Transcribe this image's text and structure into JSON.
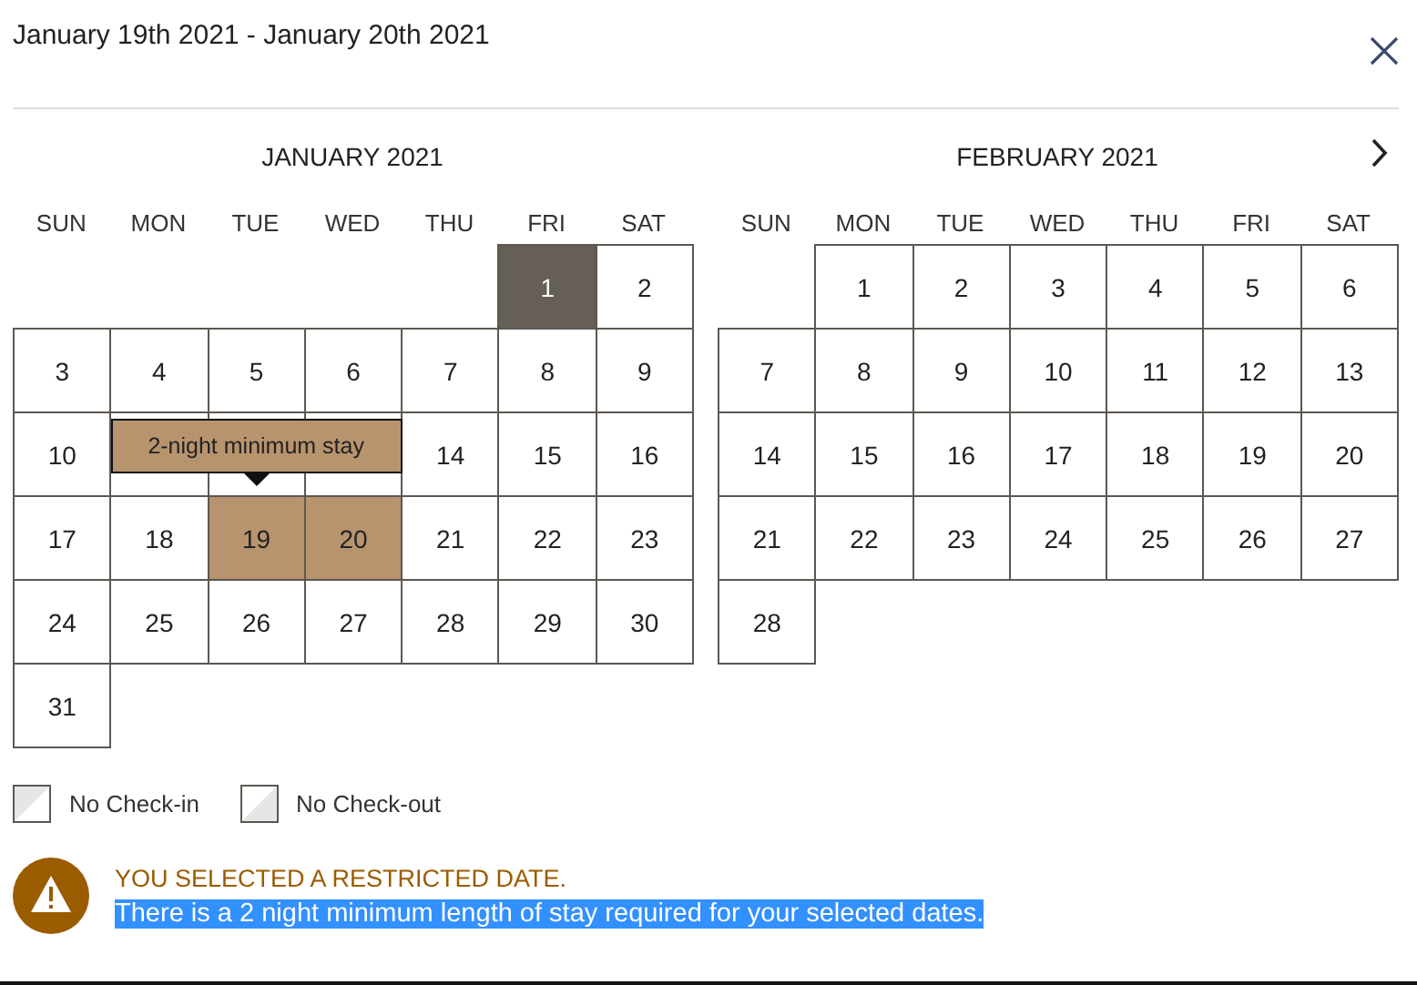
{
  "header": {
    "title": "January 19th 2021 - January 20th 2021"
  },
  "months": [
    {
      "title": "JANUARY 2021",
      "next_button": false,
      "weekdays": [
        "SUN",
        "MON",
        "TUE",
        "WED",
        "THU",
        "FRI",
        "SAT"
      ],
      "weeks": [
        [
          {
            "kind": "blank"
          },
          {
            "kind": "blank"
          },
          {
            "kind": "blank"
          },
          {
            "kind": "blank"
          },
          {
            "kind": "blank"
          },
          {
            "kind": "day",
            "day": "1",
            "selected": false,
            "unavailable": true
          },
          {
            "kind": "day",
            "day": "2",
            "selected": false,
            "unavailable": false
          }
        ],
        [
          {
            "kind": "day",
            "day": "3",
            "selected": false,
            "unavailable": false
          },
          {
            "kind": "day",
            "day": "4",
            "selected": false,
            "unavailable": false
          },
          {
            "kind": "day",
            "day": "5",
            "selected": false,
            "unavailable": false
          },
          {
            "kind": "day",
            "day": "6",
            "selected": false,
            "unavailable": false
          },
          {
            "kind": "day",
            "day": "7",
            "selected": false,
            "unavailable": false
          },
          {
            "kind": "day",
            "day": "8",
            "selected": false,
            "unavailable": false
          },
          {
            "kind": "day",
            "day": "9",
            "selected": false,
            "unavailable": false
          }
        ],
        [
          {
            "kind": "day",
            "day": "10",
            "selected": false,
            "unavailable": false
          },
          {
            "kind": "covered",
            "selected": false,
            "unavailable": false
          },
          {
            "kind": "covered",
            "selected": false,
            "unavailable": false,
            "tooltip": "2-night minimum stay"
          },
          {
            "kind": "covered",
            "selected": false,
            "unavailable": false
          },
          {
            "kind": "day",
            "day": "14",
            "selected": false,
            "unavailable": false
          },
          {
            "kind": "day",
            "day": "15",
            "selected": false,
            "unavailable": false
          },
          {
            "kind": "day",
            "day": "16",
            "selected": false,
            "unavailable": false
          }
        ],
        [
          {
            "kind": "day",
            "day": "17",
            "selected": false,
            "unavailable": false
          },
          {
            "kind": "day",
            "day": "18",
            "selected": false,
            "unavailable": false
          },
          {
            "kind": "day",
            "day": "19",
            "selected": true,
            "unavailable": false
          },
          {
            "kind": "day",
            "day": "20",
            "selected": true,
            "unavailable": false
          },
          {
            "kind": "day",
            "day": "21",
            "selected": false,
            "unavailable": false
          },
          {
            "kind": "day",
            "day": "22",
            "selected": false,
            "unavailable": false
          },
          {
            "kind": "day",
            "day": "23",
            "selected": false,
            "unavailable": false
          }
        ],
        [
          {
            "kind": "day",
            "day": "24",
            "selected": false,
            "unavailable": false
          },
          {
            "kind": "day",
            "day": "25",
            "selected": false,
            "unavailable": false
          },
          {
            "kind": "day",
            "day": "26",
            "selected": false,
            "unavailable": false
          },
          {
            "kind": "day",
            "day": "27",
            "selected": false,
            "unavailable": false
          },
          {
            "kind": "day",
            "day": "28",
            "selected": false,
            "unavailable": false
          },
          {
            "kind": "day",
            "day": "29",
            "selected": false,
            "unavailable": false
          },
          {
            "kind": "day",
            "day": "30",
            "selected": false,
            "unavailable": false
          }
        ],
        [
          {
            "kind": "day",
            "day": "31",
            "selected": false,
            "unavailable": false
          }
        ]
      ]
    },
    {
      "title": "FEBRUARY 2021",
      "next_button": true,
      "weekdays": [
        "SUN",
        "MON",
        "TUE",
        "WED",
        "THU",
        "FRI",
        "SAT"
      ],
      "weeks": [
        [
          {
            "kind": "blank"
          },
          {
            "kind": "day",
            "day": "1",
            "selected": false,
            "unavailable": false
          },
          {
            "kind": "day",
            "day": "2",
            "selected": false,
            "unavailable": false
          },
          {
            "kind": "day",
            "day": "3",
            "selected": false,
            "unavailable": false
          },
          {
            "kind": "day",
            "day": "4",
            "selected": false,
            "unavailable": false
          },
          {
            "kind": "day",
            "day": "5",
            "selected": false,
            "unavailable": false
          },
          {
            "kind": "day",
            "day": "6",
            "selected": false,
            "unavailable": false
          }
        ],
        [
          {
            "kind": "day",
            "day": "7",
            "selected": false,
            "unavailable": false
          },
          {
            "kind": "day",
            "day": "8",
            "selected": false,
            "unavailable": false
          },
          {
            "kind": "day",
            "day": "9",
            "selected": false,
            "unavailable": false
          },
          {
            "kind": "day",
            "day": "10",
            "selected": false,
            "unavailable": false
          },
          {
            "kind": "day",
            "day": "11",
            "selected": false,
            "unavailable": false
          },
          {
            "kind": "day",
            "day": "12",
            "selected": false,
            "unavailable": false
          },
          {
            "kind": "day",
            "day": "13",
            "selected": false,
            "unavailable": false
          }
        ],
        [
          {
            "kind": "day",
            "day": "14",
            "selected": false,
            "unavailable": false
          },
          {
            "kind": "day",
            "day": "15",
            "selected": false,
            "unavailable": false
          },
          {
            "kind": "day",
            "day": "16",
            "selected": false,
            "unavailable": false
          },
          {
            "kind": "day",
            "day": "17",
            "selected": false,
            "unavailable": false
          },
          {
            "kind": "day",
            "day": "18",
            "selected": false,
            "unavailable": false
          },
          {
            "kind": "day",
            "day": "19",
            "selected": false,
            "unavailable": false
          },
          {
            "kind": "day",
            "day": "20",
            "selected": false,
            "unavailable": false
          }
        ],
        [
          {
            "kind": "day",
            "day": "21",
            "selected": false,
            "unavailable": false
          },
          {
            "kind": "day",
            "day": "22",
            "selected": false,
            "unavailable": false
          },
          {
            "kind": "day",
            "day": "23",
            "selected": false,
            "unavailable": false
          },
          {
            "kind": "day",
            "day": "24",
            "selected": false,
            "unavailable": false
          },
          {
            "kind": "day",
            "day": "25",
            "selected": false,
            "unavailable": false
          },
          {
            "kind": "day",
            "day": "26",
            "selected": false,
            "unavailable": false
          },
          {
            "kind": "day",
            "day": "27",
            "selected": false,
            "unavailable": false
          }
        ],
        [
          {
            "kind": "day",
            "day": "28",
            "selected": false,
            "unavailable": false
          }
        ]
      ]
    }
  ],
  "legend": [
    {
      "label": "No Check-in"
    },
    {
      "label": "No Check-out"
    }
  ],
  "alert": {
    "title": "YOU SELECTED A RESTRICTED DATE.",
    "message": "There is a 2 night minimum length of stay required for your selected dates.",
    "highlighted": true
  }
}
